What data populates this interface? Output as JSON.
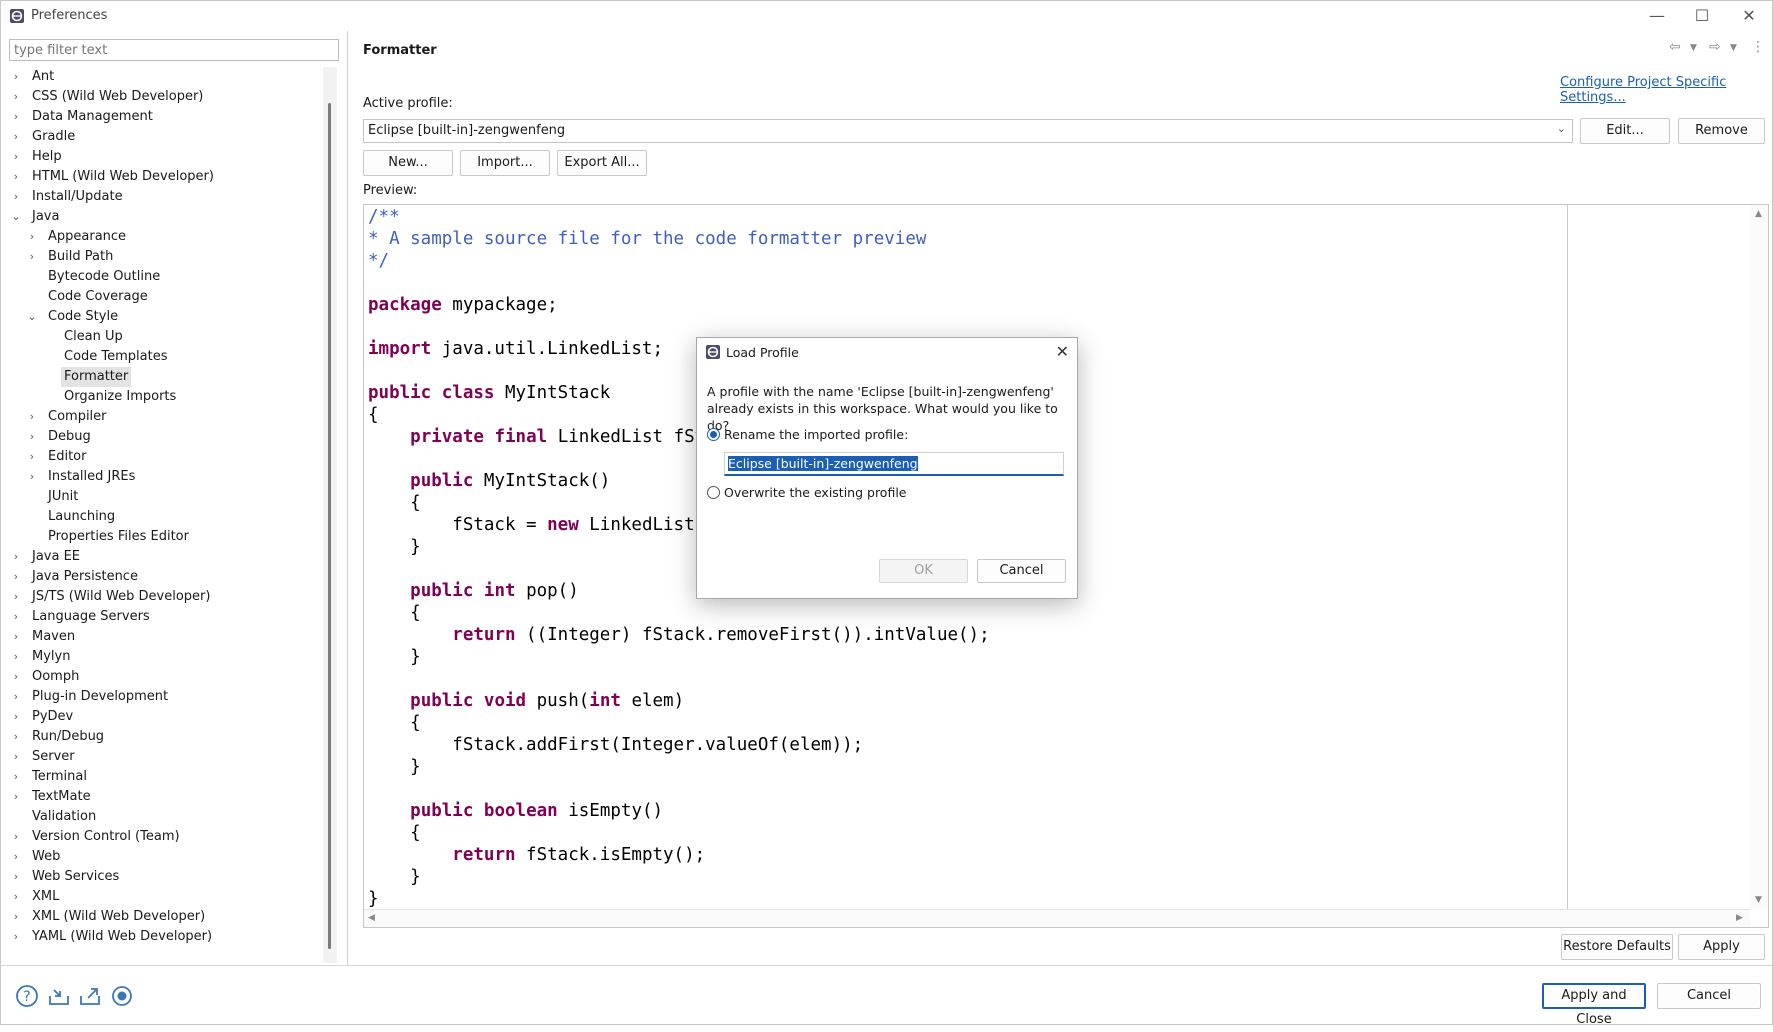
{
  "window": {
    "title": "Preferences",
    "controls": [
      "—",
      "☐",
      "✕"
    ]
  },
  "sidebar": {
    "filter_placeholder": "type filter text",
    "items": [
      {
        "label": "Ant",
        "level": 0,
        "chevron": "›"
      },
      {
        "label": "CSS (Wild Web Developer)",
        "level": 0,
        "chevron": "›"
      },
      {
        "label": "Data Management",
        "level": 0,
        "chevron": "›"
      },
      {
        "label": "Gradle",
        "level": 0,
        "chevron": "›"
      },
      {
        "label": "Help",
        "level": 0,
        "chevron": "›"
      },
      {
        "label": "HTML (Wild Web Developer)",
        "level": 0,
        "chevron": "›"
      },
      {
        "label": "Install/Update",
        "level": 0,
        "chevron": "›"
      },
      {
        "label": "Java",
        "level": 0,
        "chevron": "⌄"
      },
      {
        "label": "Appearance",
        "level": 1,
        "chevron": "›"
      },
      {
        "label": "Build Path",
        "level": 1,
        "chevron": "›"
      },
      {
        "label": "Bytecode Outline",
        "level": 1,
        "chevron": ""
      },
      {
        "label": "Code Coverage",
        "level": 1,
        "chevron": ""
      },
      {
        "label": "Code Style",
        "level": 1,
        "chevron": "⌄"
      },
      {
        "label": "Clean Up",
        "level": 2,
        "chevron": ""
      },
      {
        "label": "Code Templates",
        "level": 2,
        "chevron": ""
      },
      {
        "label": "Formatter",
        "level": 2,
        "chevron": "",
        "selected": true
      },
      {
        "label": "Organize Imports",
        "level": 2,
        "chevron": ""
      },
      {
        "label": "Compiler",
        "level": 1,
        "chevron": "›"
      },
      {
        "label": "Debug",
        "level": 1,
        "chevron": "›"
      },
      {
        "label": "Editor",
        "level": 1,
        "chevron": "›"
      },
      {
        "label": "Installed JREs",
        "level": 1,
        "chevron": "›"
      },
      {
        "label": "JUnit",
        "level": 1,
        "chevron": ""
      },
      {
        "label": "Launching",
        "level": 1,
        "chevron": ""
      },
      {
        "label": "Properties Files Editor",
        "level": 1,
        "chevron": ""
      },
      {
        "label": "Java EE",
        "level": 0,
        "chevron": "›"
      },
      {
        "label": "Java Persistence",
        "level": 0,
        "chevron": "›"
      },
      {
        "label": "JS/TS (Wild Web Developer)",
        "level": 0,
        "chevron": "›"
      },
      {
        "label": "Language Servers",
        "level": 0,
        "chevron": "›"
      },
      {
        "label": "Maven",
        "level": 0,
        "chevron": "›"
      },
      {
        "label": "Mylyn",
        "level": 0,
        "chevron": "›"
      },
      {
        "label": "Oomph",
        "level": 0,
        "chevron": "›"
      },
      {
        "label": "Plug-in Development",
        "level": 0,
        "chevron": "›"
      },
      {
        "label": "PyDev",
        "level": 0,
        "chevron": "›"
      },
      {
        "label": "Run/Debug",
        "level": 0,
        "chevron": "›"
      },
      {
        "label": "Server",
        "level": 0,
        "chevron": "›"
      },
      {
        "label": "Terminal",
        "level": 0,
        "chevron": "›"
      },
      {
        "label": "TextMate",
        "level": 0,
        "chevron": "›"
      },
      {
        "label": "Validation",
        "level": 0,
        "chevron": ""
      },
      {
        "label": "Version Control (Team)",
        "level": 0,
        "chevron": "›"
      },
      {
        "label": "Web",
        "level": 0,
        "chevron": "›"
      },
      {
        "label": "Web Services",
        "level": 0,
        "chevron": "›"
      },
      {
        "label": "XML",
        "level": 0,
        "chevron": "›"
      },
      {
        "label": "XML (Wild Web Developer)",
        "level": 0,
        "chevron": "›"
      },
      {
        "label": "YAML (Wild Web Developer)",
        "level": 0,
        "chevron": "›"
      }
    ]
  },
  "main": {
    "title": "Formatter",
    "configure_link": "Configure Project Specific Settings...",
    "active_profile_label": "Active profile:",
    "active_profile_value": "Eclipse [built-in]-zengwenfeng",
    "edit_label": "Edit...",
    "remove_label": "Remove",
    "new_label": "New...",
    "import_label": "Import...",
    "export_label": "Export All...",
    "preview_label": "Preview:",
    "restore_defaults_label": "Restore Defaults",
    "apply_label": "Apply"
  },
  "code_lines": [
    [
      {
        "t": "/**",
        "c": "cm"
      }
    ],
    [
      {
        "t": "* A sample source file for the code formatter preview",
        "c": "cm"
      }
    ],
    [
      {
        "t": "*/",
        "c": "cm"
      }
    ],
    [],
    [
      {
        "t": "package",
        "c": "kw"
      },
      {
        "t": " mypackage;",
        "c": ""
      }
    ],
    [],
    [
      {
        "t": "import",
        "c": "kw"
      },
      {
        "t": " java.util.LinkedList;",
        "c": ""
      }
    ],
    [],
    [
      {
        "t": "public",
        "c": "kw"
      },
      {
        "t": " ",
        "c": ""
      },
      {
        "t": "class",
        "c": "kw"
      },
      {
        "t": " MyIntStack",
        "c": ""
      }
    ],
    [
      {
        "t": "{",
        "c": ""
      }
    ],
    [
      {
        "t": "    ",
        "c": ""
      },
      {
        "t": "private",
        "c": "kw"
      },
      {
        "t": " ",
        "c": ""
      },
      {
        "t": "final",
        "c": "kw"
      },
      {
        "t": " LinkedList fStack;",
        "c": ""
      }
    ],
    [],
    [
      {
        "t": "    ",
        "c": ""
      },
      {
        "t": "public",
        "c": "kw"
      },
      {
        "t": " MyIntStack()",
        "c": ""
      }
    ],
    [
      {
        "t": "    {",
        "c": ""
      }
    ],
    [
      {
        "t": "        fStack = ",
        "c": ""
      },
      {
        "t": "new",
        "c": "kw"
      },
      {
        "t": " LinkedList();",
        "c": ""
      }
    ],
    [
      {
        "t": "    }",
        "c": ""
      }
    ],
    [],
    [
      {
        "t": "    ",
        "c": ""
      },
      {
        "t": "public",
        "c": "kw"
      },
      {
        "t": " ",
        "c": ""
      },
      {
        "t": "int",
        "c": "kw"
      },
      {
        "t": " pop()",
        "c": ""
      }
    ],
    [
      {
        "t": "    {",
        "c": ""
      }
    ],
    [
      {
        "t": "        ",
        "c": ""
      },
      {
        "t": "return",
        "c": "kw"
      },
      {
        "t": " ((Integer) fStack.removeFirst()).intValue();",
        "c": ""
      }
    ],
    [
      {
        "t": "    }",
        "c": ""
      }
    ],
    [],
    [
      {
        "t": "    ",
        "c": ""
      },
      {
        "t": "public",
        "c": "kw"
      },
      {
        "t": " ",
        "c": ""
      },
      {
        "t": "void",
        "c": "kw"
      },
      {
        "t": " push(",
        "c": ""
      },
      {
        "t": "int",
        "c": "kw"
      },
      {
        "t": " elem)",
        "c": ""
      }
    ],
    [
      {
        "t": "    {",
        "c": ""
      }
    ],
    [
      {
        "t": "        fStack.addFirst(Integer.valueOf(elem));",
        "c": ""
      }
    ],
    [
      {
        "t": "    }",
        "c": ""
      }
    ],
    [],
    [
      {
        "t": "    ",
        "c": ""
      },
      {
        "t": "public",
        "c": "kw"
      },
      {
        "t": " ",
        "c": ""
      },
      {
        "t": "boolean",
        "c": "kw"
      },
      {
        "t": " isEmpty()",
        "c": ""
      }
    ],
    [
      {
        "t": "    {",
        "c": ""
      }
    ],
    [
      {
        "t": "        ",
        "c": ""
      },
      {
        "t": "return",
        "c": "kw"
      },
      {
        "t": " fStack.isEmpty();",
        "c": ""
      }
    ],
    [
      {
        "t": "    }",
        "c": ""
      }
    ],
    [
      {
        "t": "}",
        "c": ""
      }
    ]
  ],
  "footer": {
    "apply_close_label": "Apply and Close",
    "cancel_label": "Cancel",
    "icons": [
      "help-icon",
      "import-icon",
      "export-icon",
      "oomph-icon"
    ]
  },
  "dialog": {
    "title": "Load Profile",
    "message": "A profile with the name 'Eclipse [built-in]-zengwenfeng' already exists in this workspace. What would you like to do?",
    "rename_label": "Rename the imported profile:",
    "rename_value": "Eclipse [built-in]-zengwenfeng",
    "overwrite_label": "Overwrite the existing profile",
    "ok_label": "OK",
    "cancel_label": "Cancel"
  },
  "colors": {
    "accent": "#1a5fb4",
    "keyword": "#7f0055",
    "comment": "#3f5fbf"
  }
}
